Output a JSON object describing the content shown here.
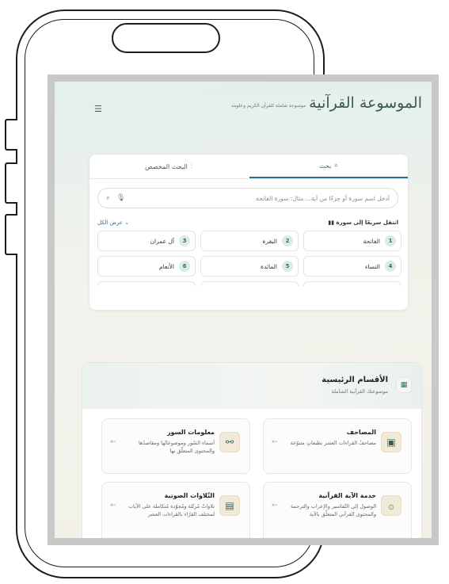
{
  "app": {
    "logo_text": "الموسوعة القرآنية",
    "logo_sub": "موسوعة شاملة للقرآن الكريم وعلومه",
    "menu_icon": "hamburger-icon"
  },
  "search_card": {
    "tabs": [
      {
        "label": "بحث",
        "icon": "search-icon"
      },
      {
        "label": "البحث المخصص",
        "icon": "sliders-icon"
      }
    ],
    "search_placeholder": "أدخل اسم سورة أو جزءًا من آية... مثال: سورة الفاتحة",
    "quick_title": "انتقل سريعًا إلى سورة",
    "view_all": "عرض الكل ⌄",
    "surahs": [
      {
        "num": "1",
        "name": "الفاتحة"
      },
      {
        "num": "2",
        "name": "البقرة"
      },
      {
        "num": "3",
        "name": "آل عمران"
      },
      {
        "num": "4",
        "name": "النساء"
      },
      {
        "num": "5",
        "name": "المائدة"
      },
      {
        "num": "6",
        "name": "الأنعام"
      }
    ]
  },
  "sections": {
    "title": "الأقسام الرئيسية",
    "subtitle": "موسوعتك القرآنية الشاملة",
    "tiles": [
      {
        "title": "المصاحف",
        "desc": "مصاحفُ القراءات العشر بطبعاتٍ متنوّعة",
        "icon": "book-icon"
      },
      {
        "title": "معلومات السور",
        "desc": "أسماء السّور وموضوعاتُها ومقاصدُها والمحتوى المتعلّق بها",
        "icon": "link-icon"
      },
      {
        "title": "خدمة الآية القرآنية",
        "desc": "الوصول إلى التّفاسير والإعراب والترجمة والمحتوى القرآني المتعلّق بالآية",
        "icon": "ayah-icon"
      },
      {
        "title": "التّلاوات الصوتية",
        "desc": "تلاواتٌ مُرتّلة ومُجوّدة مُتكاملة على الآيات لمختلف القرّاء بالقراءات العشر",
        "icon": "audio-icon"
      }
    ]
  }
}
